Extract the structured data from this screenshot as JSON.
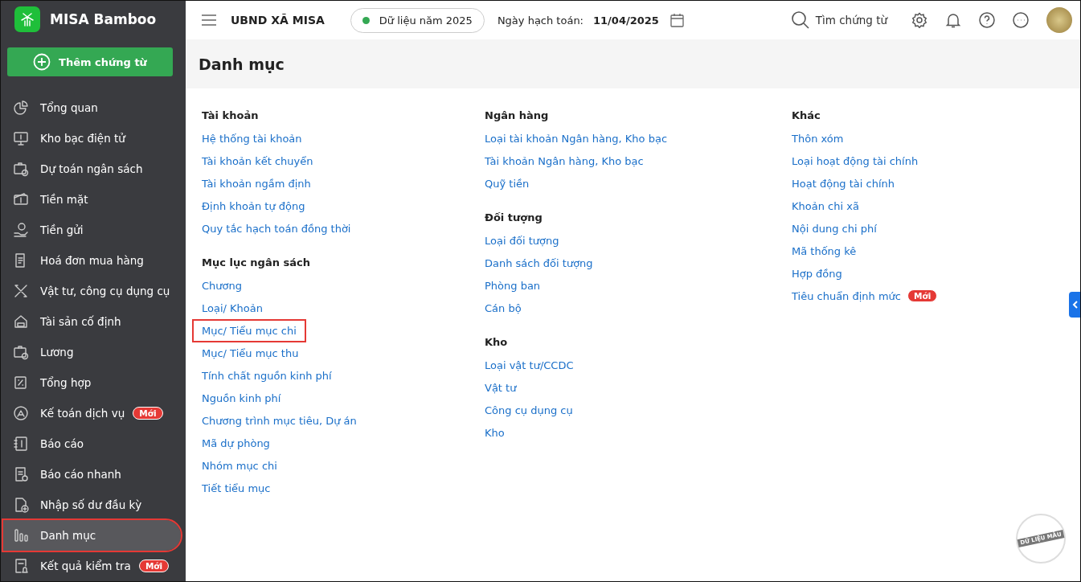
{
  "app": {
    "name": "MISA Bamboo"
  },
  "add_button": {
    "label": "Thêm chứng từ"
  },
  "sidebar": {
    "items": [
      {
        "label": "Tổng quan",
        "selected": false,
        "highlighted": false
      },
      {
        "label": "Kho bạc điện tử",
        "selected": false,
        "highlighted": false
      },
      {
        "label": "Dự toán ngân sách",
        "selected": false,
        "highlighted": false
      },
      {
        "label": "Tiền mặt",
        "selected": false,
        "highlighted": false
      },
      {
        "label": "Tiền gửi",
        "selected": false,
        "highlighted": false
      },
      {
        "label": "Hoá đơn mua hàng",
        "selected": false,
        "highlighted": false
      },
      {
        "label": "Vật tư, công cụ dụng cụ",
        "selected": false,
        "highlighted": false
      },
      {
        "label": "Tài sản cố định",
        "selected": false,
        "highlighted": false
      },
      {
        "label": "Lương",
        "selected": false,
        "highlighted": false
      },
      {
        "label": "Tổng hợp",
        "selected": false,
        "highlighted": false
      },
      {
        "label": "Kế toán dịch vụ",
        "selected": false,
        "highlighted": false,
        "badge": "Mới"
      },
      {
        "label": "Báo cáo",
        "selected": false,
        "highlighted": false
      },
      {
        "label": "Báo cáo nhanh",
        "selected": false,
        "highlighted": false
      },
      {
        "label": "Nhập số dư đầu kỳ",
        "selected": false,
        "highlighted": false
      },
      {
        "label": "Danh mục",
        "selected": true,
        "highlighted": true
      },
      {
        "label": "Kết quả kiểm tra",
        "selected": false,
        "highlighted": false,
        "badge": "Mới"
      }
    ]
  },
  "header": {
    "organization": "UBND XÃ MISA",
    "data_year": "Dữ liệu năm 2025",
    "posting_date_label": "Ngày hạch toán:",
    "posting_date": "11/04/2025",
    "search": {
      "placeholder": "Tìm chứng từ"
    }
  },
  "page_title": "Danh mục",
  "columns": [
    {
      "groups": [
        {
          "title": "Tài khoản",
          "links": [
            {
              "label": "Hệ thống tài khoản",
              "highlighted": false
            },
            {
              "label": "Tài khoản kết chuyển",
              "highlighted": false
            },
            {
              "label": "Tài khoản ngầm định",
              "highlighted": false
            },
            {
              "label": "Định khoản tự động",
              "highlighted": false
            },
            {
              "label": "Quy tắc hạch toán đồng thời",
              "highlighted": false
            }
          ]
        },
        {
          "title": "Mục lục ngân sách",
          "links": [
            {
              "label": "Chương",
              "highlighted": false
            },
            {
              "label": "Loại/ Khoản",
              "highlighted": false
            },
            {
              "label": "Mục/ Tiểu mục chi",
              "highlighted": true
            },
            {
              "label": "Mục/ Tiểu mục thu",
              "highlighted": false
            },
            {
              "label": "Tính chất nguồn kinh phí",
              "highlighted": false
            },
            {
              "label": "Nguồn kinh phí",
              "highlighted": false
            },
            {
              "label": "Chương trình mục tiêu, Dự án",
              "highlighted": false
            },
            {
              "label": "Mã dự phòng",
              "highlighted": false
            },
            {
              "label": "Nhóm mục chi",
              "highlighted": false
            },
            {
              "label": "Tiết tiểu mục",
              "highlighted": false
            }
          ]
        }
      ]
    },
    {
      "groups": [
        {
          "title": "Ngân hàng",
          "links": [
            {
              "label": "Loại tài khoản Ngân hàng, Kho bạc",
              "highlighted": false
            },
            {
              "label": "Tài khoản Ngân hàng, Kho bạc",
              "highlighted": false
            },
            {
              "label": "Quỹ tiền",
              "highlighted": false
            }
          ]
        },
        {
          "title": "Đối tượng",
          "links": [
            {
              "label": "Loại đối tượng",
              "highlighted": false
            },
            {
              "label": "Danh sách đối tượng",
              "highlighted": false
            },
            {
              "label": "Phòng ban",
              "highlighted": false
            },
            {
              "label": "Cán bộ",
              "highlighted": false
            }
          ]
        },
        {
          "title": "Kho",
          "links": [
            {
              "label": "Loại vật tư/CCDC",
              "highlighted": false
            },
            {
              "label": "Vật tư",
              "highlighted": false
            },
            {
              "label": "Công cụ dụng cụ",
              "highlighted": false
            },
            {
              "label": "Kho",
              "highlighted": false
            }
          ]
        }
      ]
    },
    {
      "groups": [
        {
          "title": "Khác",
          "links": [
            {
              "label": "Thôn xóm",
              "highlighted": false
            },
            {
              "label": "Loại hoạt động tài chính",
              "highlighted": false
            },
            {
              "label": "Hoạt động tài chính",
              "highlighted": false
            },
            {
              "label": "Khoản chi xã",
              "highlighted": false
            },
            {
              "label": "Nội dung chi phí",
              "highlighted": false
            },
            {
              "label": "Mã thống kê",
              "highlighted": false
            },
            {
              "label": "Hợp đồng",
              "highlighted": false
            },
            {
              "label": "Tiêu chuẩn định mức",
              "highlighted": false,
              "badge": "Mới"
            }
          ]
        }
      ]
    }
  ],
  "sample_stamp": "DỮ LIỆU MẪU"
}
